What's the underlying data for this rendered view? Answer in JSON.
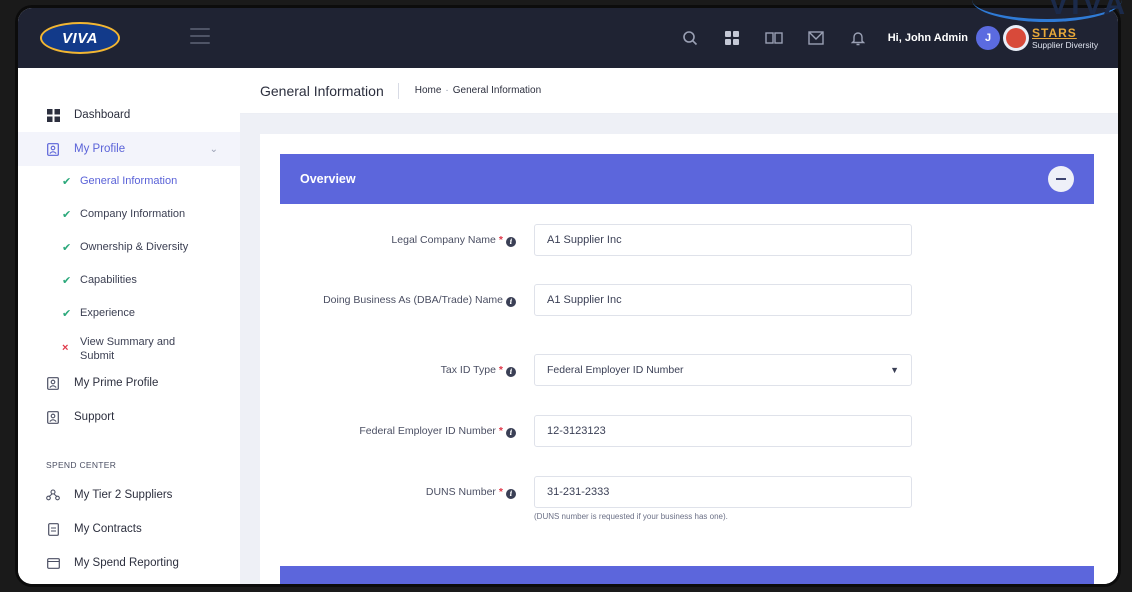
{
  "brand": {
    "logo_text": "VIVA",
    "partner_title": "STARS",
    "partner_sub": "Supplier Diversity",
    "corner_text": "VIVA"
  },
  "topbar": {
    "icons": [
      "search-icon",
      "grid-icon",
      "display-icon",
      "mail-icon",
      "bell-icon"
    ],
    "greeting": "Hi, John Admin",
    "avatar_initial": "J"
  },
  "sidebar": {
    "dashboard": "Dashboard",
    "my_profile": "My Profile",
    "profile_items": [
      {
        "label": "General Information",
        "status": "done"
      },
      {
        "label": "Company Information",
        "status": "done"
      },
      {
        "label": "Ownership & Diversity",
        "status": "done"
      },
      {
        "label": "Capabilities",
        "status": "done"
      },
      {
        "label": "Experience",
        "status": "done"
      },
      {
        "label": "View Summary and Submit",
        "status": "incomplete"
      }
    ],
    "my_prime_profile": "My Prime Profile",
    "support": "Support",
    "section_label": "SPEND CENTER",
    "tier2": "My Tier 2 Suppliers",
    "contracts": "My Contracts",
    "spend_reporting": "My Spend Reporting"
  },
  "header": {
    "title": "General Information",
    "breadcrumb_home": "Home",
    "breadcrumb_current": "General Information"
  },
  "overview": {
    "title": "Overview",
    "fields": {
      "legal_name": {
        "label": "Legal Company Name",
        "value": "A1 Supplier Inc"
      },
      "dba": {
        "label": "Doing Business As (DBA/Trade) Name",
        "value": "A1 Supplier Inc"
      },
      "tax_id_type": {
        "label": "Tax ID Type",
        "value": "Federal Employer ID Number"
      },
      "fein": {
        "label": "Federal Employer ID Number",
        "value": "12-3123123"
      },
      "duns": {
        "label": "DUNS Number",
        "value": "31-231-2333",
        "help": "(DUNS number is requested if your business has one)."
      }
    }
  },
  "colors": {
    "accent": "#5c66dc",
    "topbar": "#1f2333",
    "required": "#e0394a",
    "done": "#2aa87a"
  }
}
